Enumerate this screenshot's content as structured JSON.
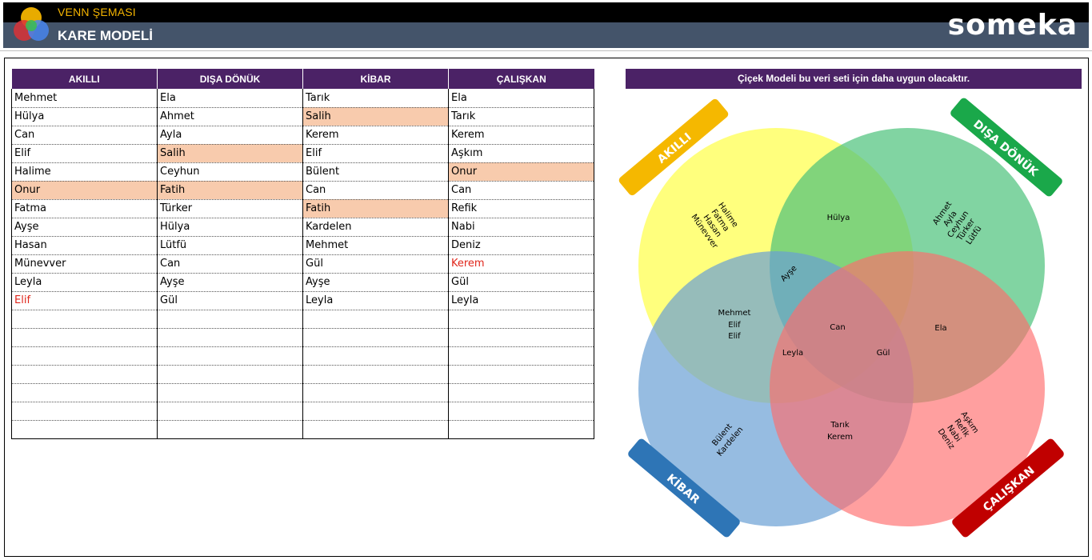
{
  "header": {
    "subtitle": "VENN ŞEMASI",
    "title": "KARE MODELİ",
    "brand": "someka"
  },
  "table": {
    "headers": [
      "AKILLI",
      "DIŞA DÖNÜK",
      "KİBAR",
      "ÇALIŞKAN"
    ],
    "rows": [
      [
        "Mehmet",
        "Ela",
        "Tarık",
        "Ela"
      ],
      [
        "Hülya",
        "Ahmet",
        "Salih",
        "Tarık"
      ],
      [
        "Can",
        "Ayla",
        "Kerem",
        "Kerem"
      ],
      [
        "Elif",
        "Salih",
        "Elif",
        "Aşkım"
      ],
      [
        "Halime",
        "Ceyhun",
        "Bülent",
        "Onur"
      ],
      [
        "Onur",
        "Fatih",
        "Can",
        "Can"
      ],
      [
        "Fatma",
        "Türker",
        "Fatih",
        "Refik"
      ],
      [
        "Ayşe",
        "Hülya",
        "Kardelen",
        "Nabi"
      ],
      [
        "Hasan",
        "Lütfü",
        "Mehmet",
        "Deniz"
      ],
      [
        "Münevver",
        "Can",
        "Gül",
        "Kerem"
      ],
      [
        "Leyla",
        "Ayşe",
        "Ayşe",
        "Gül"
      ],
      [
        "Elif",
        "Gül",
        "Leyla",
        "Leyla"
      ],
      [
        "",
        "",
        "",
        ""
      ],
      [
        "",
        "",
        "",
        ""
      ],
      [
        "",
        "",
        "",
        ""
      ],
      [
        "",
        "",
        "",
        ""
      ],
      [
        "",
        "",
        "",
        ""
      ],
      [
        "",
        "",
        "",
        ""
      ],
      [
        "",
        "",
        "",
        ""
      ]
    ],
    "highlighted_cells": [
      [
        1,
        2
      ],
      [
        3,
        1
      ],
      [
        4,
        3
      ],
      [
        5,
        0
      ],
      [
        5,
        1
      ],
      [
        6,
        2
      ]
    ],
    "red_cells": [
      [
        9,
        3
      ],
      [
        11,
        0
      ]
    ],
    "highlight_color": "#f8cbad",
    "red_text_color": "#e0261b",
    "header_color": "#4b2266"
  },
  "venn": {
    "title": "Çiçek Modeli bu veri seti için daha uygun olacaktır.",
    "labels": {
      "akilli": "AKILLI",
      "disa_donuk": "DIŞA DÖNÜK",
      "kibar": "KİBAR",
      "caliskan": "ÇALIŞKAN"
    },
    "regions": {
      "akilli_only": [
        "Halime",
        "Fatma",
        "Hasan",
        "Münevver"
      ],
      "akilli_disa": [
        "Hülya"
      ],
      "disa_only": [
        "Ahmet",
        "Ayla",
        "Ceyhun",
        "Türker",
        "Lütfü"
      ],
      "akilli_disa_kibar": [
        "Ayşe"
      ],
      "akilli_kibar": [
        "Mehmet",
        "Elif",
        "Elif"
      ],
      "all_four": [
        "Can"
      ],
      "disa_caliskan": [
        "Ela"
      ],
      "akilli_kibar_caliskan": [
        "Leyla"
      ],
      "akilli_disa_caliskan": [
        "Gül"
      ],
      "kibar_only": [
        "Bülent",
        "Kardelen"
      ],
      "kibar_caliskan": [
        "Tarık",
        "Kerem"
      ],
      "caliskan_only": [
        "Aşkım",
        "Refik",
        "Nabi",
        "Deniz"
      ]
    },
    "colors": {
      "akilli": "#ffff66",
      "disa_donuk": "#4cc27a",
      "kibar": "#6a9fd4",
      "caliskan": "#ff6b6b",
      "akilli_badge": "#f5b800",
      "disa_badge": "#1aa84a",
      "kibar_badge": "#2e75b6",
      "caliskan_badge": "#c00000"
    }
  }
}
